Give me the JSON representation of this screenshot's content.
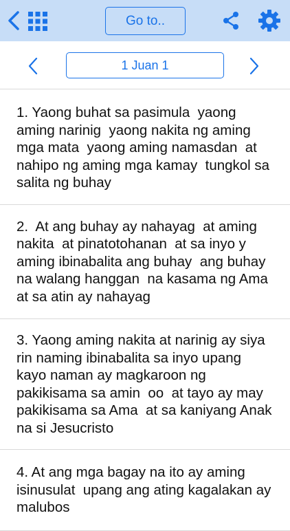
{
  "toolbar": {
    "goto_label": "Go to..",
    "back_icon": "chevron-left-icon",
    "grid_icon": "grid-icon",
    "share_icon": "share-icon",
    "settings_icon": "gear-icon",
    "accent_color": "#1a73e8",
    "bar_color": "#c7ddf7"
  },
  "navigation": {
    "book_chapter": "1 Juan 1",
    "prev_icon": "chevron-left-icon",
    "next_icon": "chevron-right-icon"
  },
  "verses": [
    {
      "text": "1. Yaong buhat sa pasimula  yaong aming narinig  yaong nakita ng aming mga mata  yaong aming namasdan  at nahipo ng aming mga kamay  tungkol sa salita ng buhay"
    },
    {
      "text": "2.  At ang buhay ay nahayag  at aming nakita  at pinatotohanan  at sa inyo y aming ibinabalita ang buhay  ang buhay na walang hanggan  na kasama ng Ama at sa atin ay nahayag"
    },
    {
      "text": "3. Yaong aming nakita at narinig ay siya rin naming ibinabalita sa inyo upang kayo naman ay magkaroon ng pakikisama sa amin  oo  at tayo ay may pakikisama sa Ama  at sa kaniyang Anak na si Jesucristo"
    },
    {
      "text": "4. At ang mga bagay na ito ay aming isinusulat  upang ang ating kagalakan ay malubos"
    }
  ]
}
